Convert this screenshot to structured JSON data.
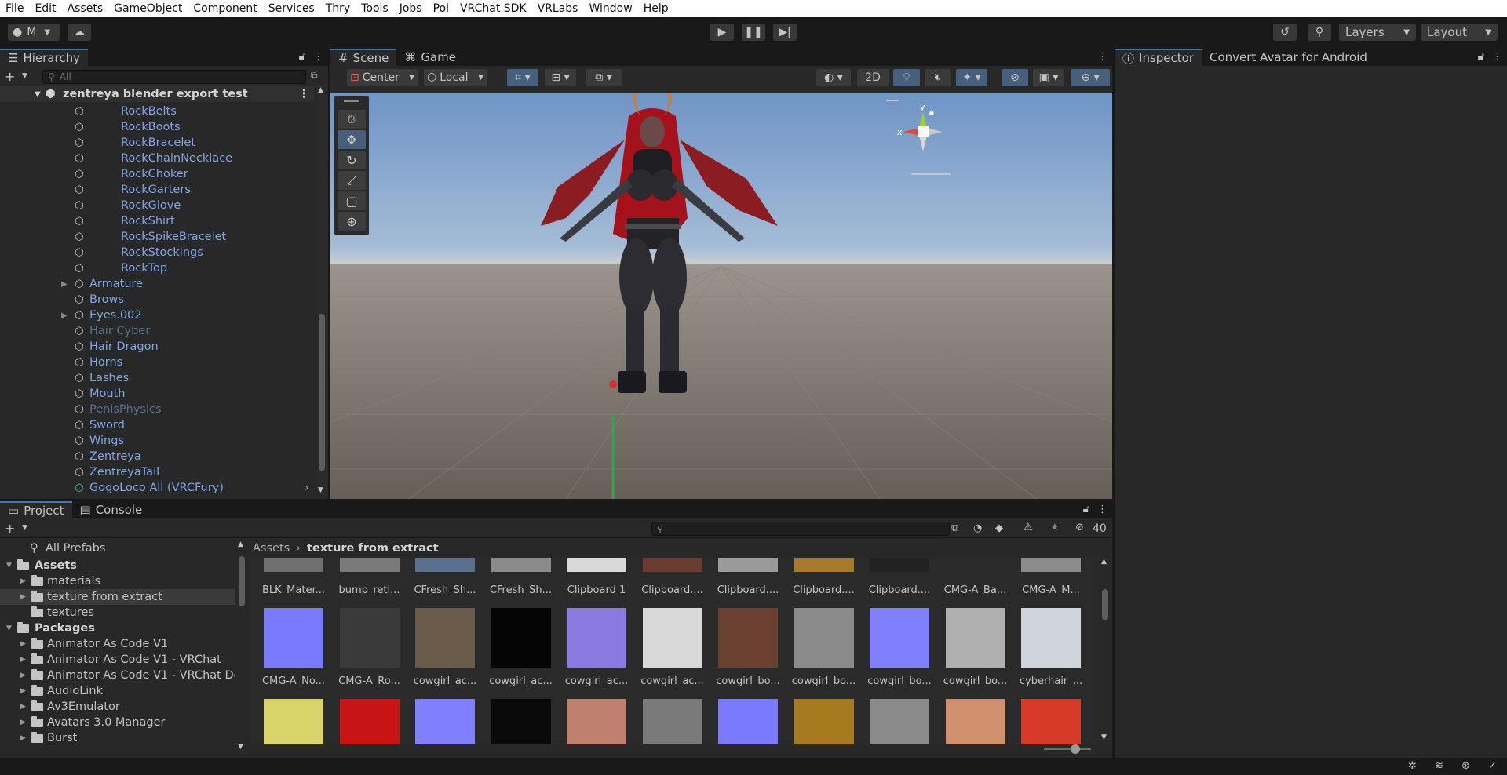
{
  "menu": [
    "File",
    "Edit",
    "Assets",
    "GameObject",
    "Component",
    "Services",
    "Thry",
    "Tools",
    "Jobs",
    "Poi",
    "VRChat SDK",
    "VRLabs",
    "Window",
    "Help"
  ],
  "toolbar": {
    "account_label": "M",
    "layers_label": "Layers",
    "layout_label": "Layout"
  },
  "hierarchy": {
    "tab_label": "Hierarchy",
    "search_placeholder": "All",
    "scene_name": "zentreya blender export test",
    "rows": [
      {
        "label": "RockBelts",
        "indent": 2,
        "dim": false,
        "arrow": false
      },
      {
        "label": "RockBoots",
        "indent": 2,
        "dim": false,
        "arrow": false
      },
      {
        "label": "RockBracelet",
        "indent": 2,
        "dim": false,
        "arrow": false
      },
      {
        "label": "RockChainNecklace",
        "indent": 2,
        "dim": false,
        "arrow": false
      },
      {
        "label": "RockChoker",
        "indent": 2,
        "dim": false,
        "arrow": false
      },
      {
        "label": "RockGarters",
        "indent": 2,
        "dim": false,
        "arrow": false
      },
      {
        "label": "RockGlove",
        "indent": 2,
        "dim": false,
        "arrow": false
      },
      {
        "label": "RockShirt",
        "indent": 2,
        "dim": false,
        "arrow": false
      },
      {
        "label": "RockSpikeBracelet",
        "indent": 2,
        "dim": false,
        "arrow": false
      },
      {
        "label": "RockStockings",
        "indent": 2,
        "dim": false,
        "arrow": false
      },
      {
        "label": "RockTop",
        "indent": 2,
        "dim": false,
        "arrow": false
      },
      {
        "label": "Armature",
        "indent": 1,
        "dim": false,
        "arrow": true
      },
      {
        "label": "Brows",
        "indent": 1,
        "dim": false,
        "arrow": false
      },
      {
        "label": "Eyes.002",
        "indent": 1,
        "dim": false,
        "arrow": true
      },
      {
        "label": "Hair Cyber",
        "indent": 1,
        "dim": true,
        "arrow": false
      },
      {
        "label": "Hair Dragon",
        "indent": 1,
        "dim": false,
        "arrow": false
      },
      {
        "label": "Horns",
        "indent": 1,
        "dim": false,
        "arrow": false
      },
      {
        "label": "Lashes",
        "indent": 1,
        "dim": false,
        "arrow": false
      },
      {
        "label": "Mouth",
        "indent": 1,
        "dim": false,
        "arrow": false
      },
      {
        "label": "PenisPhysics",
        "indent": 1,
        "dim": true,
        "arrow": false
      },
      {
        "label": "Sword",
        "indent": 1,
        "dim": false,
        "arrow": false
      },
      {
        "label": "Wings",
        "indent": 1,
        "dim": false,
        "arrow": false
      },
      {
        "label": "Zentreya",
        "indent": 1,
        "dim": false,
        "arrow": false
      },
      {
        "label": "ZentreyaTail",
        "indent": 1,
        "dim": false,
        "arrow": false
      },
      {
        "label": "GogoLoco All (VRCFury)",
        "indent": 1,
        "dim": false,
        "arrow": false
      }
    ]
  },
  "scene": {
    "tab_scene": "Scene",
    "tab_game": "Game",
    "pivot_label": "Center",
    "space_label": "Local",
    "mode_2d": "2D",
    "gizmo_x": "x",
    "gizmo_y": "y"
  },
  "inspector": {
    "tab_label": "Inspector",
    "tab2_label": "Convert Avatar for Android"
  },
  "project": {
    "tab_project": "Project",
    "tab_console": "Console",
    "hidden_count": "40",
    "favorites_label": "All Prefabs",
    "tree": [
      {
        "label": "Assets",
        "level": 0,
        "bold": true,
        "arrow": "open"
      },
      {
        "label": "materials",
        "level": 1,
        "bold": false,
        "arrow": "closed"
      },
      {
        "label": "texture from extract",
        "level": 1,
        "bold": false,
        "arrow": "closed",
        "selected": true
      },
      {
        "label": "textures",
        "level": 1,
        "bold": false,
        "arrow": "none"
      },
      {
        "label": "Packages",
        "level": 0,
        "bold": true,
        "arrow": "open"
      },
      {
        "label": "Animator As Code V1",
        "level": 1,
        "bold": false,
        "arrow": "closed"
      },
      {
        "label": "Animator As Code V1 - VRChat",
        "level": 1,
        "bold": false,
        "arrow": "closed"
      },
      {
        "label": "Animator As Code V1 - VRChat De",
        "level": 1,
        "bold": false,
        "arrow": "closed"
      },
      {
        "label": "AudioLink",
        "level": 1,
        "bold": false,
        "arrow": "closed"
      },
      {
        "label": "Av3Emulator",
        "level": 1,
        "bold": false,
        "arrow": "closed"
      },
      {
        "label": "Avatars 3.0 Manager",
        "level": 1,
        "bold": false,
        "arrow": "closed"
      },
      {
        "label": "Burst",
        "level": 1,
        "bold": false,
        "arrow": "closed"
      }
    ],
    "breadcrumb_root": "Assets",
    "breadcrumb_current": "texture from extract",
    "row1": [
      "BLK_Mater...",
      "bump_reti...",
      "CFresh_Sh...",
      "CFresh_Sh...",
      "Clipboard 1",
      "Clipboard....",
      "Clipboard....",
      "Clipboard....",
      "Clipboard....",
      "CMG-A_Ba...",
      "CMG-A_M..."
    ],
    "row2": [
      "CMG-A_No...",
      "CMG-A_Ro...",
      "cowgirl_ac...",
      "cowgirl_ac...",
      "cowgirl_ac...",
      "cowgirl_ac...",
      "cowgirl_bo...",
      "cowgirl_bo...",
      "cowgirl_bo...",
      "cowgirl_bo...",
      "cyberhair_..."
    ],
    "row1_colors": [
      "#707070",
      "#7a7a7a",
      "#5a6e8e",
      "#8a8a8a",
      "#d9d9d9",
      "#6a3b30",
      "#9a9a9a",
      "#a67a2a",
      "#222222",
      "#2a2a2a",
      "#8c8c8c"
    ],
    "row2_colors": [
      "#7a7aff",
      "#3a3a3a",
      "#6a5a4a",
      "#050505",
      "#8a7ae0",
      "#d8d8d8",
      "#6a4030",
      "#8a8a8a",
      "#8080ff",
      "#b0b0b0",
      "#d0d4dc"
    ],
    "row3_colors": [
      "#d8d46a",
      "#c81414",
      "#8080ff",
      "#0a0a0a",
      "#c08070",
      "#7a7a7a",
      "#7a7aff",
      "#a87a20",
      "#8a8a8a",
      "#d09070",
      "#d83a2a"
    ]
  },
  "colors": {
    "accent": "#3a79bb",
    "link": "#7fa6e8"
  }
}
